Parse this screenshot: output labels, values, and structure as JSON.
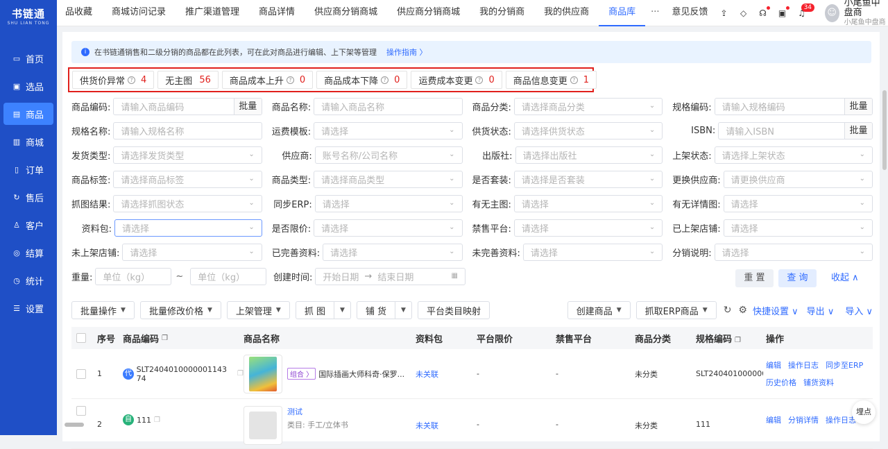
{
  "brand": {
    "name": "书链通",
    "sub": "SHU LIAN TONG"
  },
  "sidebar": {
    "items": [
      {
        "label": "首页",
        "icon": "monitor-icon"
      },
      {
        "label": "选品",
        "icon": "select-icon"
      },
      {
        "label": "商品",
        "icon": "product-icon"
      },
      {
        "label": "商城",
        "icon": "mall-icon"
      },
      {
        "label": "订单",
        "icon": "order-icon"
      },
      {
        "label": "售后",
        "icon": "aftersale-icon"
      },
      {
        "label": "客户",
        "icon": "customer-icon"
      },
      {
        "label": "结算",
        "icon": "settle-icon"
      },
      {
        "label": "统计",
        "icon": "stats-icon"
      },
      {
        "label": "设置",
        "icon": "settings-icon"
      }
    ]
  },
  "tabs": [
    "品收藏",
    "商城访问记录",
    "推广渠道管理",
    "商品详情",
    "供应商分销商城",
    "供应商分销商城",
    "我的分销商",
    "我的供应商",
    "商品库"
  ],
  "tab_more": "···",
  "feedback": "意见反馈",
  "header": {
    "badge_count": "34",
    "user_name": "小尾鱼中盘商",
    "user_sub": "小尾鱼中盘商"
  },
  "notice": {
    "text": "在书链通销售和二级分销的商品都在此列表，可在此对商品进行编辑、上下架等管理",
    "link": "操作指南 〉"
  },
  "alerts": [
    {
      "label": "供货价异常",
      "count": "4"
    },
    {
      "label": "无主图",
      "count": "56"
    },
    {
      "label": "商品成本上升",
      "count": "0"
    },
    {
      "label": "商品成本下降",
      "count": "0"
    },
    {
      "label": "运费成本变更",
      "count": "0"
    },
    {
      "label": "商品信息变更",
      "count": "1"
    }
  ],
  "filters": {
    "r1": [
      {
        "label": "商品编码:",
        "placeholder": "请输入商品编码",
        "batch": "批量"
      },
      {
        "label": "商品名称:",
        "placeholder": "请输入商品名称"
      },
      {
        "label": "商品分类:",
        "placeholder": "请选择商品分类"
      },
      {
        "label": "规格编码:",
        "placeholder": "请输入规格编码",
        "batch": "批量"
      }
    ],
    "r2": [
      {
        "label": "规格名称:",
        "placeholder": "请输入规格名称"
      },
      {
        "label": "运费模板:",
        "placeholder": "请选择"
      },
      {
        "label": "供货状态:",
        "placeholder": "请选择供货状态"
      },
      {
        "label": "ISBN:",
        "placeholder": "请输入ISBN",
        "batch": "批量"
      }
    ],
    "r3": [
      {
        "label": "发货类型:",
        "placeholder": "请选择发货类型"
      },
      {
        "label": "供应商:",
        "placeholder": "账号名称/公司名称"
      },
      {
        "label": "出版社:",
        "placeholder": "请选择出版社"
      },
      {
        "label": "上架状态:",
        "placeholder": "请选择上架状态"
      }
    ],
    "r4": [
      {
        "label": "商品标签:",
        "placeholder": "请选择商品标签"
      },
      {
        "label": "商品类型:",
        "placeholder": "请选择商品类型"
      },
      {
        "label": "是否套装:",
        "placeholder": "请选择是否套装"
      },
      {
        "label": "更换供应商:",
        "placeholder": "请更换供应商"
      }
    ],
    "r5": [
      {
        "label": "抓图结果:",
        "placeholder": "请选择抓图状态"
      },
      {
        "label": "同步ERP:",
        "placeholder": "请选择"
      },
      {
        "label": "有无主图:",
        "placeholder": "请选择"
      },
      {
        "label": "有无详情图:",
        "placeholder": "请选择"
      }
    ],
    "r6": [
      {
        "label": "资料包:",
        "placeholder": "请选择"
      },
      {
        "label": "是否限价:",
        "placeholder": "请选择"
      },
      {
        "label": "禁售平台:",
        "placeholder": "请选择"
      },
      {
        "label": "已上架店铺:",
        "placeholder": "请选择"
      }
    ],
    "r7": [
      {
        "label": "未上架店铺:",
        "placeholder": "请选择"
      },
      {
        "label": "已完善资料:",
        "placeholder": "请选择"
      },
      {
        "label": "未完善资料:",
        "placeholder": "请选择"
      },
      {
        "label": "分销说明:",
        "placeholder": "请选择"
      }
    ],
    "weight_label": "重量:",
    "weight_from": "单位（kg）",
    "weight_sep": "~",
    "weight_to": "单位（kg）",
    "created_label": "创建时间:",
    "date_start": "开始日期",
    "date_arrow": "→",
    "date_end": "结束日期",
    "reset": "重 置",
    "query": "查 询",
    "collapse": "收起 ∧"
  },
  "toolbar": {
    "batch_ops": "批量操作",
    "batch_price": "批量修改价格",
    "shelf": "上架管理",
    "grab": "抓 图",
    "supply": "铺 货",
    "category_map": "平台类目映射",
    "create": "创建商品",
    "erp": "抓取ERP商品",
    "quick_set": "快捷设置",
    "export": "导出",
    "import": "导入"
  },
  "table": {
    "headers": [
      "序号",
      "商品编码",
      "商品名称",
      "资料包",
      "平台限价",
      "禁售平台",
      "商品分类",
      "规格编码",
      "操作"
    ],
    "rows": [
      {
        "idx": "1",
        "tag": "代",
        "code": "SLT2404010000001143​74",
        "combo": "组合 〉",
        "name": "国际插画大师科奇·保罗...",
        "pack": "未关联",
        "price": "-",
        "ban": "-",
        "cat": "未分类",
        "spec": "SLT24040100000011",
        "ops1": [
          "编辑",
          "操作日志",
          "同步至ERP"
        ],
        "ops2": [
          "历史价格",
          "铺货资料"
        ]
      },
      {
        "idx": "2",
        "tag": "自",
        "code": "111",
        "name": "测试",
        "sub": "类目: 手工/立体书",
        "pack": "未关联",
        "price": "-",
        "ban": "-",
        "cat": "未分类",
        "spec": "111",
        "ops1": [
          "编辑",
          "分销详情",
          "操作日志"
        ]
      }
    ]
  },
  "float_btn": "埋点"
}
